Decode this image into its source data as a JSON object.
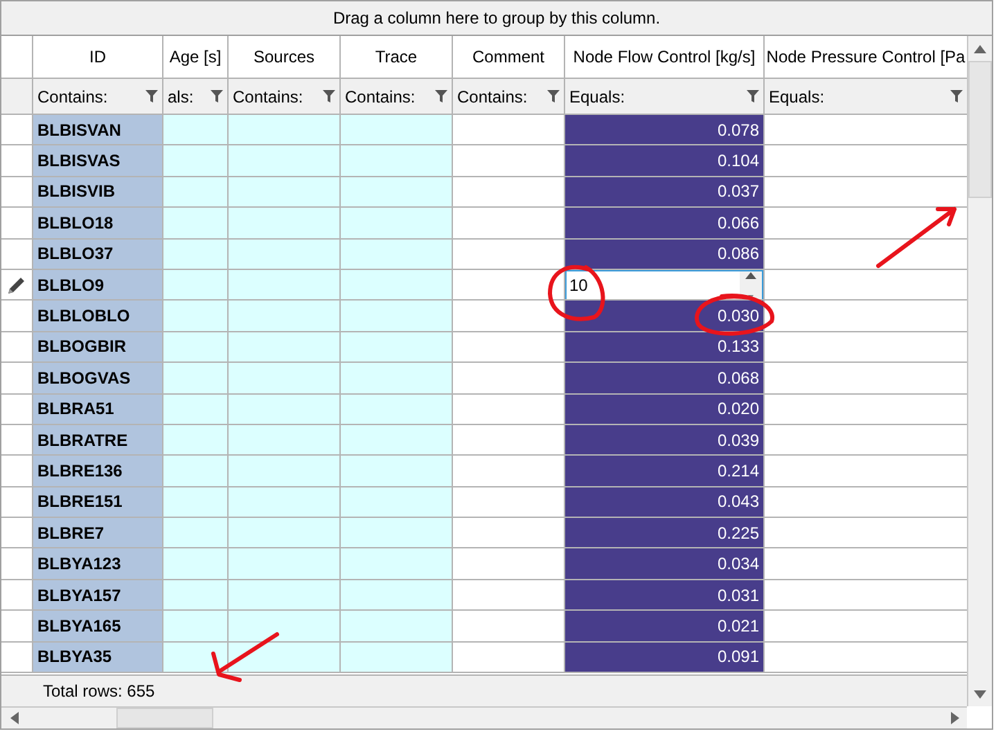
{
  "group_panel": {
    "text": "Drag a column here to group by this column."
  },
  "columns": [
    {
      "header": "ID",
      "filter": "Contains:",
      "color": "#b0c4de"
    },
    {
      "header": "Age [s]",
      "filter": "als:",
      "color": "#dcffff"
    },
    {
      "header": "Sources",
      "filter": "Contains:",
      "color": "#dcffff"
    },
    {
      "header": "Trace",
      "filter": "Contains:",
      "color": "#dcffff"
    },
    {
      "header": "Comment",
      "filter": "Contains:",
      "color": "#ffffff"
    },
    {
      "header": "Node Flow Control [kg/s]",
      "filter": "Equals:",
      "color": "#483d8b"
    },
    {
      "header": "Node Pressure Control [Pa",
      "filter": "Equals:",
      "color": "#ffffff"
    }
  ],
  "rows": [
    {
      "id": "BLBISVAN",
      "flow": "0.078",
      "editing": false
    },
    {
      "id": "BLBISVAS",
      "flow": "0.104",
      "editing": false
    },
    {
      "id": "BLBISVIB",
      "flow": "0.037",
      "editing": false
    },
    {
      "id": "BLBLO18",
      "flow": "0.066",
      "editing": false
    },
    {
      "id": "BLBLO37",
      "flow": "0.086",
      "editing": false
    },
    {
      "id": "BLBLO9",
      "flow": "10",
      "editing": true
    },
    {
      "id": "BLBLOBLO",
      "flow": "0.030",
      "editing": false
    },
    {
      "id": "BLBOGBIR",
      "flow": "0.133",
      "editing": false
    },
    {
      "id": "BLBOGVAS",
      "flow": "0.068",
      "editing": false
    },
    {
      "id": "BLBRA51",
      "flow": "0.020",
      "editing": false
    },
    {
      "id": "BLBRATRE",
      "flow": "0.039",
      "editing": false
    },
    {
      "id": "BLBRE136",
      "flow": "0.214",
      "editing": false
    },
    {
      "id": "BLBRE151",
      "flow": "0.043",
      "editing": false
    },
    {
      "id": "BLBRE7",
      "flow": "0.225",
      "editing": false
    },
    {
      "id": "BLBYA123",
      "flow": "0.034",
      "editing": false
    },
    {
      "id": "BLBYA157",
      "flow": "0.031",
      "editing": false
    },
    {
      "id": "BLBYA165",
      "flow": "0.021",
      "editing": false
    },
    {
      "id": "BLBYA35",
      "flow": "0.091",
      "editing": false
    }
  ],
  "footer": {
    "total_rows": "Total rows: 655"
  }
}
